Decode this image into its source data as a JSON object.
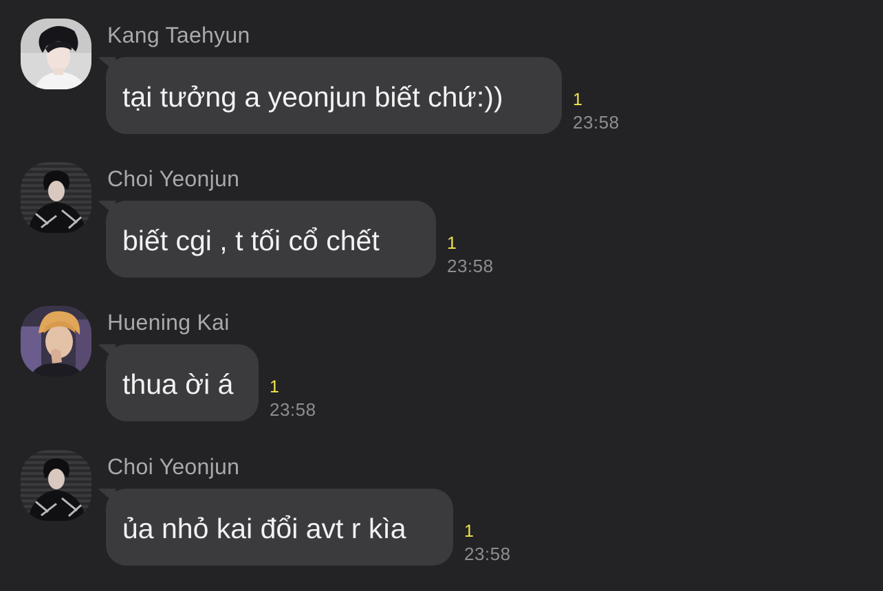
{
  "messages": [
    {
      "sender": "Kang Taehyun",
      "text": "tại tưởng a yeonjun biết chứ:))",
      "unread": "1",
      "time": "23:58",
      "avatar_icon": "profile-photo-avatar"
    },
    {
      "sender": "Choi Yeonjun",
      "text": "biết cgi , t tối cổ chết",
      "unread": "1",
      "time": "23:58",
      "avatar_icon": "profile-photo-avatar"
    },
    {
      "sender": "Huening Kai",
      "text": "thua ời á",
      "unread": "1",
      "time": "23:58",
      "avatar_icon": "profile-photo-avatar"
    },
    {
      "sender": "Choi Yeonjun",
      "text": "ủa nhỏ kai đổi avt r kìa",
      "unread": "1",
      "time": "23:58",
      "avatar_icon": "profile-photo-avatar"
    }
  ],
  "colors": {
    "background": "#232325",
    "bubble": "#3b3b3e",
    "sender_text": "#a9a9ad",
    "message_text": "#f2f2f2",
    "unread_count": "#f5e54b",
    "timestamp": "#8d8d92"
  }
}
